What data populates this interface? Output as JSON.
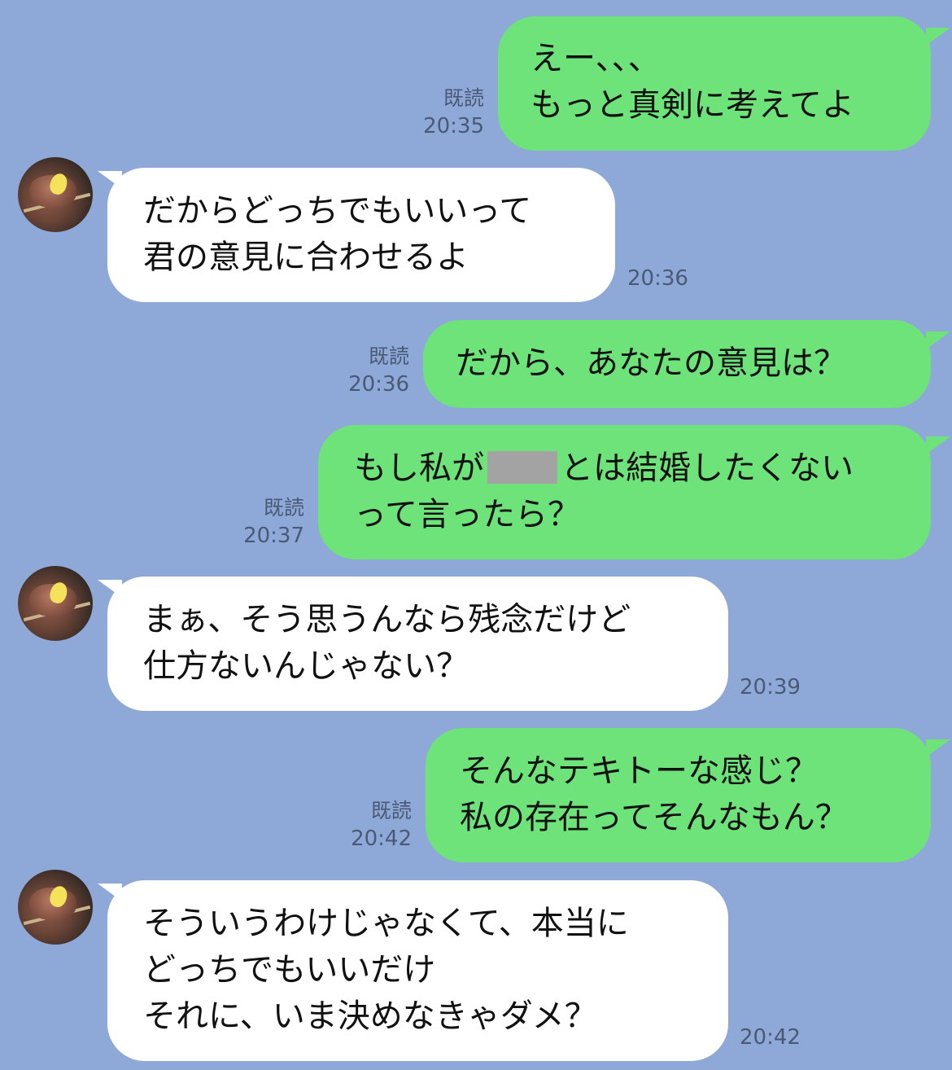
{
  "messages": [
    {
      "side": "out",
      "read": "既読",
      "time": "20:35",
      "lines": [
        "えー、、、",
        "もっと真剣に考えてよ"
      ]
    },
    {
      "side": "in",
      "time": "20:36",
      "lines": [
        "だからどっちでもいいって",
        "君の意見に合わせるよ"
      ]
    },
    {
      "side": "out",
      "read": "既読",
      "time": "20:36",
      "lines": [
        "だから、あなたの意見は？"
      ]
    },
    {
      "side": "out",
      "read": "既読",
      "time": "20:37",
      "lines": [
        "もし私が",
        "とは結婚したくない",
        "って言ったら？"
      ]
    },
    {
      "side": "in",
      "time": "20:39",
      "lines": [
        "まぁ、そう思うんなら残念だけど",
        "仕方ないんじゃない？"
      ]
    },
    {
      "side": "out",
      "read": "既読",
      "time": "20:42",
      "lines": [
        "そんなテキトーな感じ？",
        "私の存在ってそんなもん？"
      ]
    },
    {
      "side": "in",
      "time": "20:42",
      "lines": [
        "そういうわけじゃなくて、本当に",
        "どっちでもいいだけ",
        "それに、いま決めなきゃダメ？"
      ]
    }
  ],
  "colors": {
    "background": "#8ea9d8",
    "outgoing_bubble": "#6ee37a",
    "incoming_bubble": "#ffffff",
    "meta_text": "#4a5a74"
  },
  "icons": {
    "avatar": "food-skewer-avatar-icon",
    "censor": "redaction-bar"
  }
}
